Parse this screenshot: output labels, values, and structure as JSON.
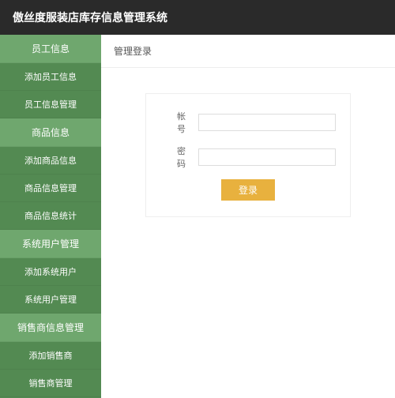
{
  "header": {
    "title": "傲丝度服装店库存信息管理系统"
  },
  "sidebar": {
    "groups": [
      {
        "header": "员工信息",
        "items": [
          "添加员工信息",
          "员工信息管理"
        ]
      },
      {
        "header": "商品信息",
        "items": [
          "添加商品信息",
          "商品信息管理",
          "商品信息统计"
        ]
      },
      {
        "header": "系统用户管理",
        "items": [
          "添加系统用户",
          "系统用户管理"
        ]
      },
      {
        "header": "销售商信息管理",
        "items": [
          "添加销售商",
          "销售商管理"
        ]
      }
    ]
  },
  "main": {
    "panel_title": "管理登录",
    "form": {
      "account_label": "帐 号",
      "password_label": "密 码",
      "account_value": "",
      "password_value": "",
      "login_button": "登录"
    }
  }
}
